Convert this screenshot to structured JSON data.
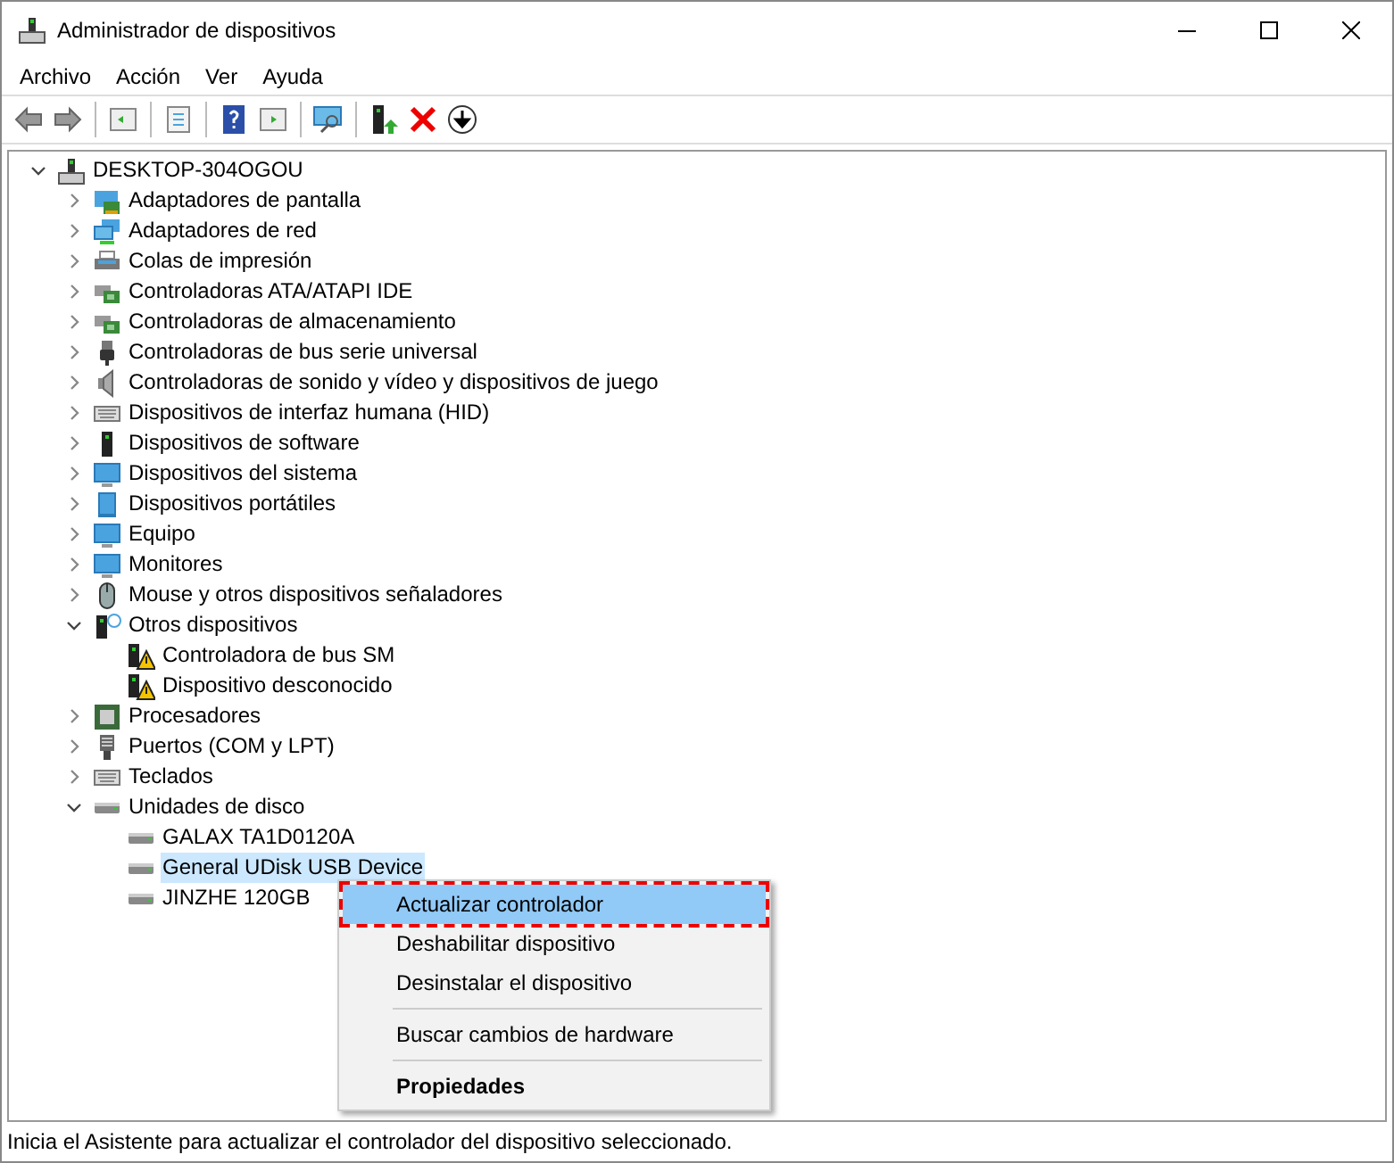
{
  "window": {
    "title": "Administrador de dispositivos"
  },
  "menu_bar": [
    "Archivo",
    "Acción",
    "Ver",
    "Ayuda"
  ],
  "tree": {
    "label": "DESKTOP-304OGOU",
    "kind": "computer",
    "expanded": true,
    "children": [
      {
        "label": "Adaptadores de pantalla",
        "kind": "display",
        "expanded": false
      },
      {
        "label": "Adaptadores de red",
        "kind": "network",
        "expanded": false
      },
      {
        "label": "Colas de impresión",
        "kind": "printer",
        "expanded": false
      },
      {
        "label": "Controladoras ATA/ATAPI IDE",
        "kind": "card",
        "expanded": false
      },
      {
        "label": "Controladoras de almacenamiento",
        "kind": "card",
        "expanded": false
      },
      {
        "label": "Controladoras de bus serie universal",
        "kind": "usb",
        "expanded": false
      },
      {
        "label": "Controladoras de sonido y vídeo y dispositivos de juego",
        "kind": "speaker",
        "expanded": false
      },
      {
        "label": "Dispositivos de interfaz humana (HID)",
        "kind": "keyboard",
        "expanded": false
      },
      {
        "label": "Dispositivos de software",
        "kind": "tower",
        "expanded": false
      },
      {
        "label": "Dispositivos del sistema",
        "kind": "monitor",
        "expanded": false
      },
      {
        "label": "Dispositivos portátiles",
        "kind": "tablet",
        "expanded": false
      },
      {
        "label": "Equipo",
        "kind": "monitor",
        "expanded": false
      },
      {
        "label": "Monitores",
        "kind": "monitor",
        "expanded": false
      },
      {
        "label": "Mouse y otros dispositivos señaladores",
        "kind": "mouse",
        "expanded": false
      },
      {
        "label": "Otros dispositivos",
        "kind": "unknown",
        "expanded": true,
        "children": [
          {
            "label": "Controladora de bus SM",
            "kind": "warning",
            "selected": false
          },
          {
            "label": "Dispositivo desconocido",
            "kind": "warning",
            "selected": false
          }
        ]
      },
      {
        "label": "Procesadores",
        "kind": "cpu",
        "expanded": false
      },
      {
        "label": "Puertos (COM y LPT)",
        "kind": "port",
        "expanded": false
      },
      {
        "label": "Teclados",
        "kind": "keyboard",
        "expanded": false
      },
      {
        "label": "Unidades de disco",
        "kind": "disk",
        "expanded": true,
        "children": [
          {
            "label": "GALAX TA1D0120A",
            "kind": "disk",
            "selected": false
          },
          {
            "label": "General UDisk USB Device",
            "kind": "disk",
            "selected": true
          },
          {
            "label": "JINZHE 120GB",
            "kind": "disk",
            "selected": false
          }
        ]
      }
    ]
  },
  "context_menu": [
    {
      "kind": "item",
      "label": "Actualizar controlador",
      "selected": true,
      "default": false
    },
    {
      "kind": "item",
      "label": "Deshabilitar dispositivo",
      "selected": false,
      "default": false
    },
    {
      "kind": "item",
      "label": "Desinstalar el dispositivo",
      "selected": false,
      "default": false
    },
    {
      "kind": "separator"
    },
    {
      "kind": "item",
      "label": "Buscar cambios de hardware",
      "selected": false,
      "default": false
    },
    {
      "kind": "separator"
    },
    {
      "kind": "item",
      "label": "Propiedades",
      "selected": false,
      "default": true
    }
  ],
  "status_bar": "Inicia el Asistente para actualizar el controlador del dispositivo seleccionado."
}
